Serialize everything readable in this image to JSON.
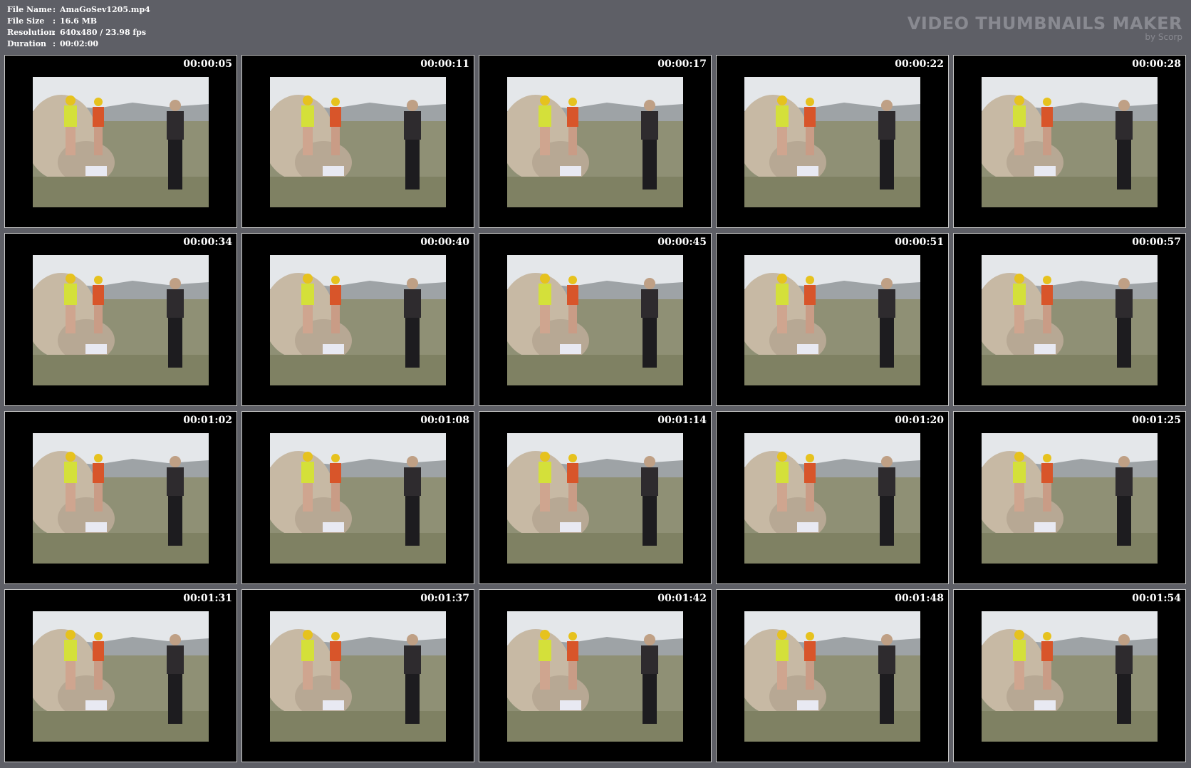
{
  "info": [
    {
      "label": "File Name",
      "value": "AmaGoSev1205.mp4"
    },
    {
      "label": "File Size",
      "value": "16.6 MB"
    },
    {
      "label": "Resolution",
      "value": "640x480 / 23.98 fps"
    },
    {
      "label": "Duration",
      "value": "00:02:00"
    }
  ],
  "separator": ":",
  "brand": {
    "title": "VIDEO THUMBNAILS MAKER",
    "subtitle": "by Scorp"
  },
  "thumbnails": [
    {
      "time": "00:00:05"
    },
    {
      "time": "00:00:11"
    },
    {
      "time": "00:00:17"
    },
    {
      "time": "00:00:22"
    },
    {
      "time": "00:00:28"
    },
    {
      "time": "00:00:34"
    },
    {
      "time": "00:00:40"
    },
    {
      "time": "00:00:45"
    },
    {
      "time": "00:00:51"
    },
    {
      "time": "00:00:57"
    },
    {
      "time": "00:01:02"
    },
    {
      "time": "00:01:08"
    },
    {
      "time": "00:01:14"
    },
    {
      "time": "00:01:20"
    },
    {
      "time": "00:01:25"
    },
    {
      "time": "00:01:31"
    },
    {
      "time": "00:01:37"
    },
    {
      "time": "00:01:42"
    },
    {
      "time": "00:01:48"
    },
    {
      "time": "00:01:54"
    }
  ]
}
